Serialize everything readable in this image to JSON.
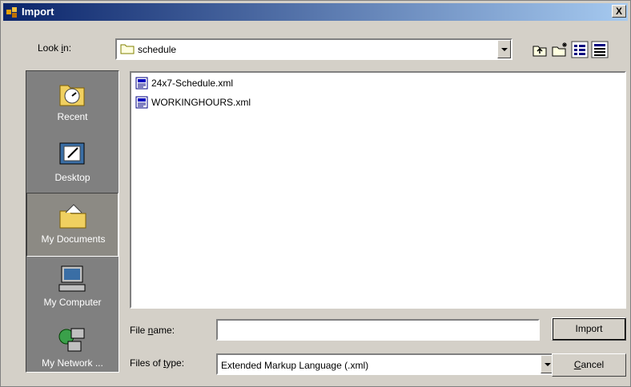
{
  "window": {
    "title": "Import",
    "close": "X"
  },
  "lookin": {
    "label": "Look in:",
    "label_u": "i",
    "value": "schedule"
  },
  "places": [
    {
      "label": "Recent"
    },
    {
      "label": "Desktop"
    },
    {
      "label": "My Documents"
    },
    {
      "label": "My Computer"
    },
    {
      "label": "My Network ..."
    }
  ],
  "files": [
    {
      "name": "24x7-Schedule.xml"
    },
    {
      "name": "WORKINGHOURS.xml"
    }
  ],
  "filename": {
    "label_pre": "File ",
    "label_u": "n",
    "label_post": "ame:",
    "value": ""
  },
  "filetype": {
    "label_pre": "Files of ",
    "label_u": "t",
    "label_post": "ype:",
    "value": "Extended Markup Language (.xml)"
  },
  "buttons": {
    "import": "Import",
    "cancel_u": "C",
    "cancel_rest": "ancel"
  },
  "colors": {
    "title_start": "#0a246a",
    "title_end": "#a6caf0",
    "places_bg": "#808080",
    "face": "#d4d0c8"
  }
}
